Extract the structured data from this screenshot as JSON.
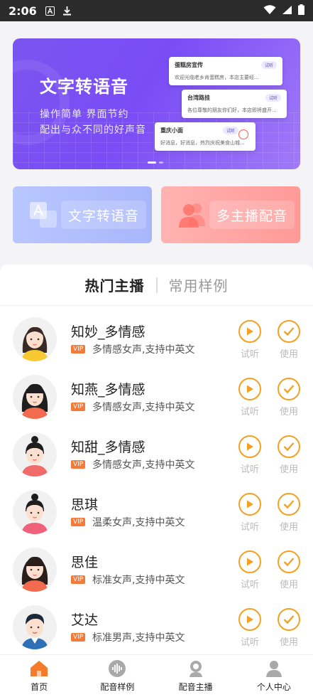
{
  "status_bar": {
    "time": "2:06"
  },
  "banner": {
    "title": "文字转语音",
    "subtitle_line1": "操作简单 界面节约",
    "subtitle_line2": "配出与众不同的好声音",
    "cards": [
      {
        "title": "蛋糕房宣传",
        "text": "欢迎光临老乡肯蛋糕房，本店主要经...",
        "badge": "试听"
      },
      {
        "title": "台湾路挂",
        "text": "各位尊敬的朋友你们好，本店即将盛开...",
        "badge": "试听"
      },
      {
        "title": "重庆小面",
        "text": "好消息，好消息，热烈庆祝美食山城...",
        "badge": "试听"
      }
    ]
  },
  "features": [
    {
      "label": "文字转语音",
      "icon": "translate-icon"
    },
    {
      "label": "多主播配音",
      "icon": "people-icon"
    }
  ],
  "tabs": {
    "active": "热门主播",
    "inactive": "常用样例"
  },
  "actions": {
    "play_label": "试听",
    "use_label": "使用",
    "vip_label": "VIP"
  },
  "hosts": [
    {
      "name": "知妙_多情感",
      "desc": "多情感女声,支持中英文",
      "avatar": "female-avatar"
    },
    {
      "name": "知燕_多情感",
      "desc": "多情感女声,支持中英文",
      "avatar": "female-avatar"
    },
    {
      "name": "知甜_多情感",
      "desc": "多情感女声,支持中英文",
      "avatar": "female-avatar"
    },
    {
      "name": "思琪",
      "desc": "温柔女声,支持中英文",
      "avatar": "female-avatar"
    },
    {
      "name": "思佳",
      "desc": "标准女声,支持中英文",
      "avatar": "female-avatar"
    },
    {
      "name": "艾达",
      "desc": "标准男声,支持中英文",
      "avatar": "male-avatar"
    }
  ],
  "tabbar": [
    {
      "label": "首页",
      "icon": "home-icon",
      "active": true
    },
    {
      "label": "配音样例",
      "icon": "waveform-icon",
      "active": false
    },
    {
      "label": "配音主播",
      "icon": "host-icon",
      "active": false
    },
    {
      "label": "个人中心",
      "icon": "user-icon",
      "active": false
    }
  ],
  "colors": {
    "accent": "#f5a022",
    "vip": "#f47a3a",
    "active_tab": "#f57a2a",
    "banner": "#7a55f0"
  }
}
